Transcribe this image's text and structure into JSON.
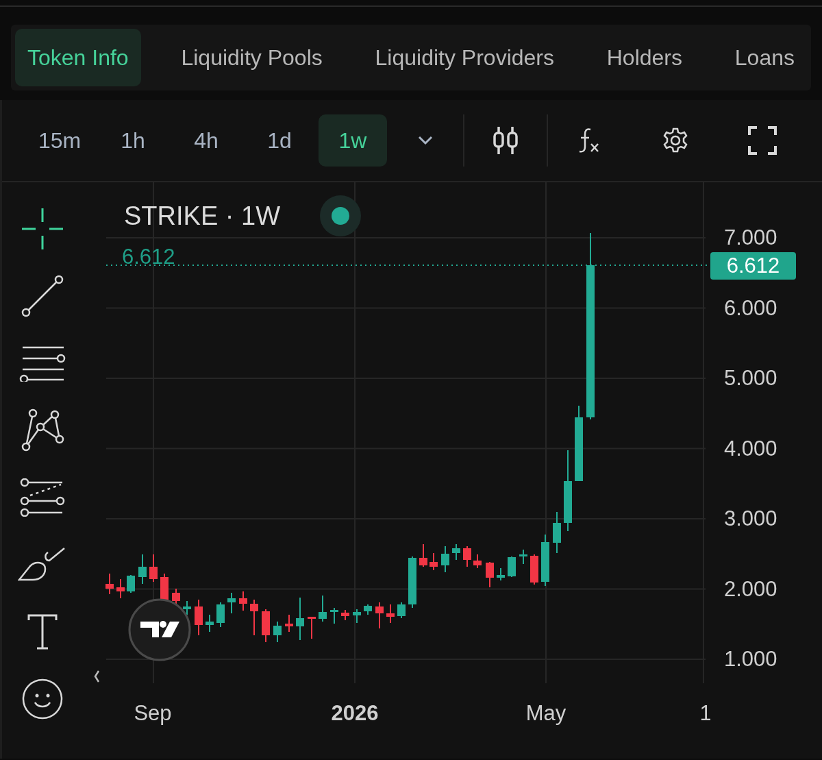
{
  "tabs": [
    {
      "label": "Token Info",
      "selected": true
    },
    {
      "label": "Liquidity Pools",
      "selected": false
    },
    {
      "label": "Liquidity Providers",
      "selected": false
    },
    {
      "label": "Holders",
      "selected": false
    },
    {
      "label": "Loans",
      "selected": false
    }
  ],
  "timeframes": [
    {
      "label": "15m",
      "selected": false
    },
    {
      "label": "1h",
      "selected": false
    },
    {
      "label": "4h",
      "selected": false
    },
    {
      "label": "1d",
      "selected": false
    },
    {
      "label": "1w",
      "selected": true
    }
  ],
  "tools": [
    {
      "kind": "crosshair",
      "selected": true
    },
    {
      "kind": "trendline",
      "selected": false
    },
    {
      "kind": "lines",
      "selected": false
    },
    {
      "kind": "pattern",
      "selected": false
    },
    {
      "kind": "fibonacci",
      "selected": false
    },
    {
      "kind": "brush",
      "selected": false
    },
    {
      "kind": "text",
      "selected": false
    },
    {
      "kind": "emoji",
      "selected": false
    }
  ],
  "chart": {
    "title": "STRIKE · 1W",
    "last_price": "6.612",
    "price_tag": "6.612",
    "y_axis_labels": [
      "7.000",
      "6.000",
      "5.000",
      "4.000",
      "3.000",
      "2.000",
      "1.000"
    ],
    "x_axis_labels": [
      {
        "label": "Sep",
        "kind": "month"
      },
      {
        "label": "2026",
        "kind": "year"
      },
      {
        "label": "May",
        "kind": "month"
      },
      {
        "label": "1",
        "kind": "month"
      }
    ]
  }
}
